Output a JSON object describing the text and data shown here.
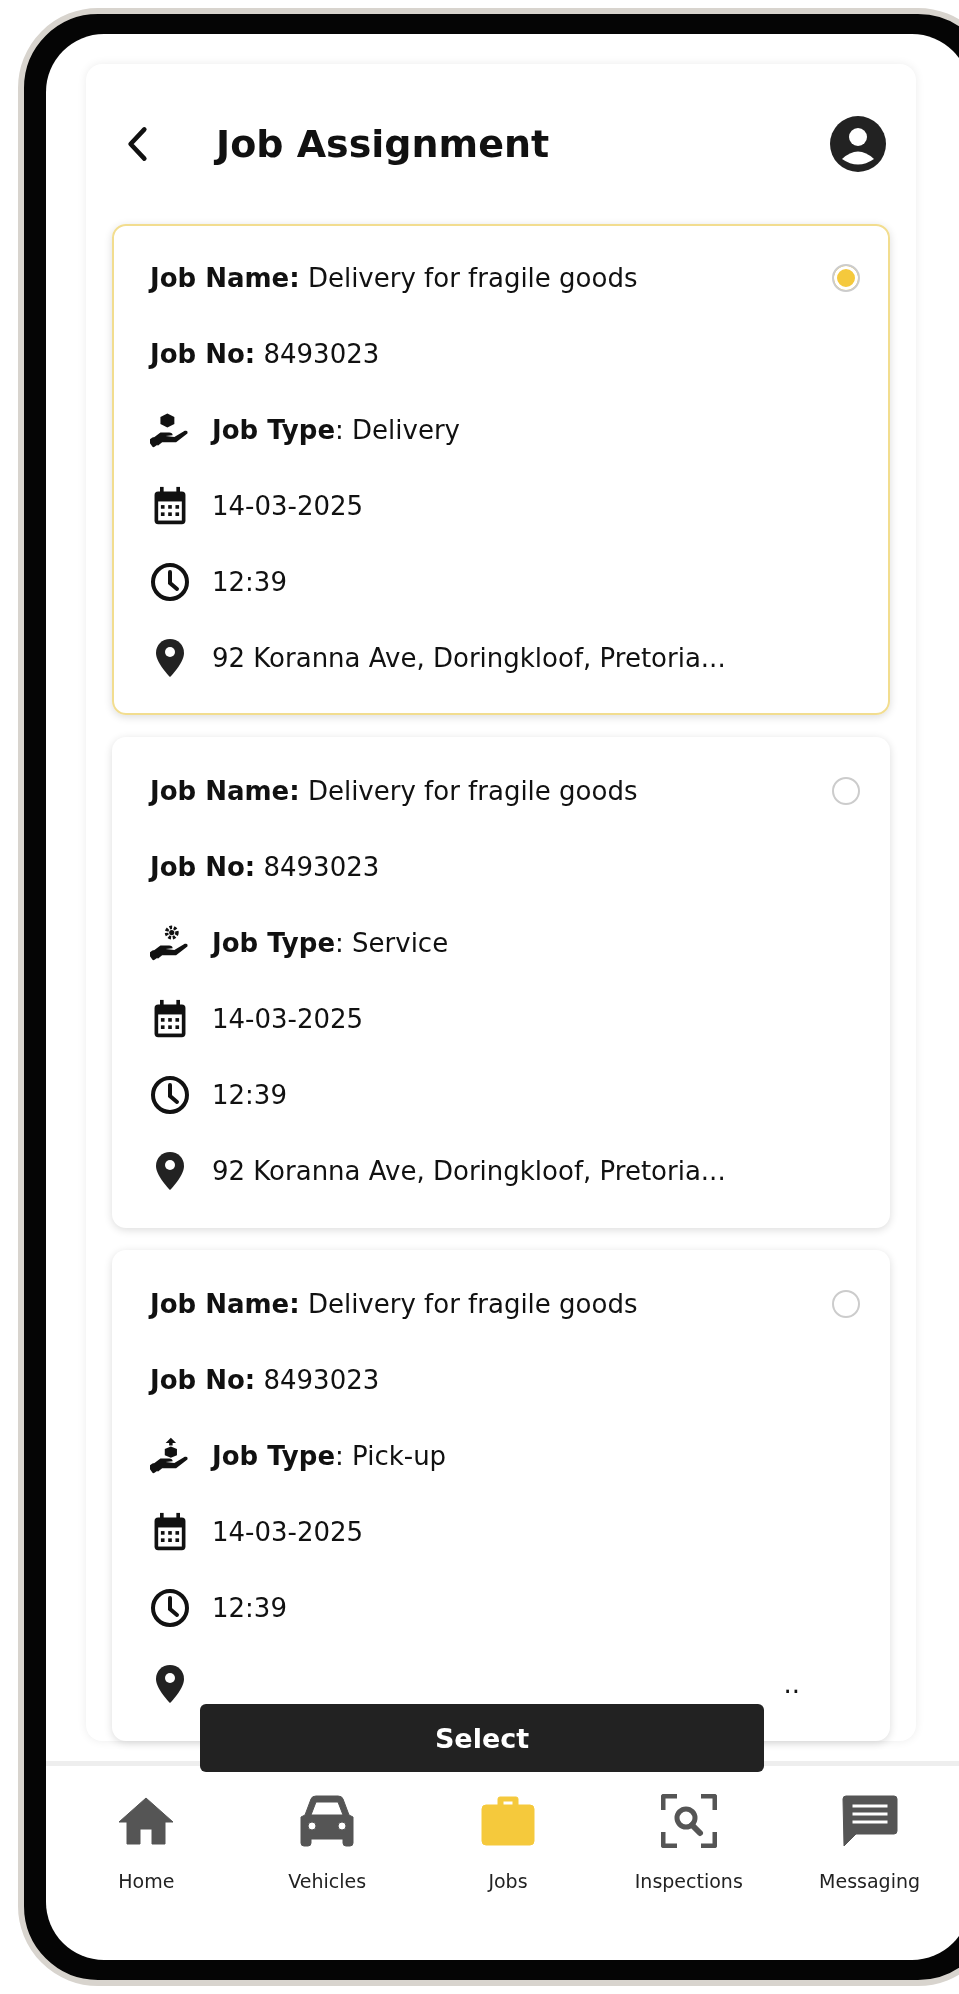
{
  "header": {
    "title": "Job Assignment"
  },
  "jobs": [
    {
      "name_line": "**Job Name:** Delivery for fragile goods",
      "number_line": "**Job No:** 8493023",
      "type_line": "**Job Type**: Delivery",
      "kind": "delivery",
      "date": "14-03-2025",
      "time": "12:39",
      "address": "92 Koranna Ave, Doringkloof, Pretoria...",
      "selected": true
    },
    {
      "name_line": "**Job Name:** Delivery for fragile goods",
      "number_line": "**Job No:** 8493023",
      "type_line": "**Job Type**: Service",
      "kind": "service",
      "date": "14-03-2025",
      "time": "12:39",
      "address": "92 Koranna Ave, Doringkloof, Pretoria...",
      "selected": false
    },
    {
      "name_line": "**Job Name:** Delivery for fragile goods",
      "number_line": "**Job No:** 8493023",
      "type_line": "**Job Type**: Pick-up",
      "kind": "pickup",
      "date": "14-03-2025",
      "time": "12:39",
      "address": "..",
      "selected": false
    }
  ],
  "select_button": "Select",
  "nav": [
    {
      "label": "Home",
      "kind": "home",
      "selected": false
    },
    {
      "label": "Vehicles",
      "kind": "car",
      "selected": false
    },
    {
      "label": "Jobs",
      "kind": "jobs",
      "selected": true
    },
    {
      "label": "Inspections",
      "kind": "inspect",
      "selected": false
    },
    {
      "label": "Messaging",
      "kind": "message",
      "selected": false
    }
  ]
}
